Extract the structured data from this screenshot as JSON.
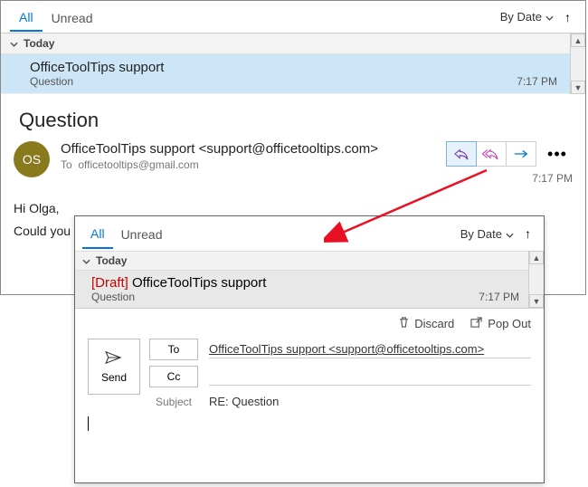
{
  "top": {
    "tabs": {
      "all": "All",
      "unread": "Unread"
    },
    "sort": {
      "label": "By Date",
      "dir": "↑"
    },
    "group": "Today",
    "row": {
      "from": "OfficeToolTips support",
      "subject": "Question",
      "time": "7:17 PM"
    }
  },
  "reading": {
    "subject": "Question",
    "avatar": "OS",
    "from": "OfficeToolTips support <support@officetooltips.com>",
    "to_label": "To",
    "to_value": "officetooltips@gmail.com",
    "time": "7:17 PM",
    "body_line1": "Hi Olga,",
    "body_line2": "Could you"
  },
  "popup": {
    "tabs": {
      "all": "All",
      "unread": "Unread"
    },
    "sort": {
      "label": "By Date",
      "dir": "↑"
    },
    "group": "Today",
    "row": {
      "draft": "[Draft]",
      "from": "OfficeToolTips support",
      "subject": "Question",
      "time": "7:17 PM"
    },
    "actions": {
      "discard": "Discard",
      "popout": "Pop Out"
    },
    "compose": {
      "send": "Send",
      "to_btn": "To",
      "to_value": "OfficeToolTips support <support@officetooltips.com>",
      "cc_btn": "Cc",
      "subject_label": "Subject",
      "subject_value": "RE: Question"
    }
  }
}
